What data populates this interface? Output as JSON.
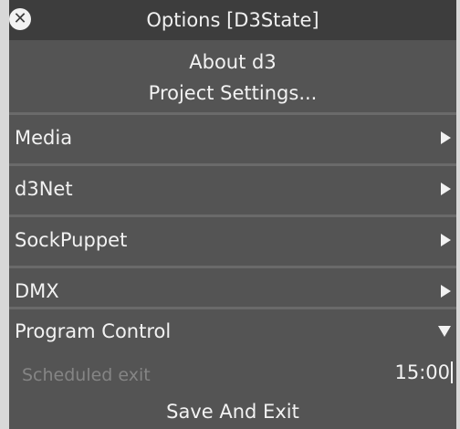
{
  "window": {
    "title": "Options [D3State]",
    "close_glyph": "✕"
  },
  "top_items": {
    "about": "About d3",
    "project_settings": "Project Settings..."
  },
  "menu": {
    "media": "Media",
    "d3net": "d3Net",
    "sockpuppet": "SockPuppet",
    "dmx": "DMX",
    "program_control": "Program Control"
  },
  "program_control": {
    "scheduled_exit_label": "Scheduled exit",
    "scheduled_exit_value": "15:00",
    "save_and_exit": "Save And Exit"
  },
  "icons": {
    "close": "close-icon",
    "expand": "chevron-right-icon",
    "collapse": "chevron-down-icon"
  },
  "colors": {
    "panel_bg": "#545454",
    "title_bg": "#3d3d3d",
    "separator": "#6a6a6a",
    "text": "#f2f2f2",
    "muted_text": "#858585"
  }
}
